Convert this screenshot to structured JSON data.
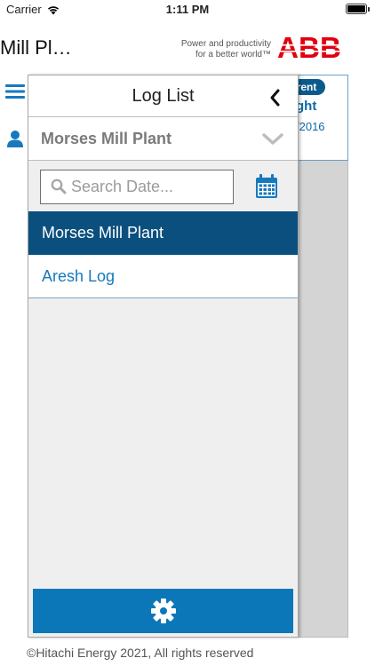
{
  "status_bar": {
    "carrier": "Carrier",
    "time": "1:11 PM",
    "icons": [
      "wifi-icon",
      "battery-icon"
    ]
  },
  "header": {
    "title": "Mill Pl…",
    "tagline_line1": "Power and productivity",
    "tagline_line2": "for a better world™",
    "logo": "ABB",
    "brand_color": "#e2000f"
  },
  "side_icons": [
    "menu-icon",
    "user-icon"
  ],
  "background_card": {
    "badge": "rrent",
    "shift": "ght",
    "date": "/2016"
  },
  "drawer": {
    "title": "Log List",
    "plant_select": {
      "selected": "Morses Mill Plant"
    },
    "search": {
      "placeholder": "Search Date...",
      "value": ""
    },
    "logs": [
      {
        "label": "Morses Mill Plant",
        "selected": true
      },
      {
        "label": "Aresh Log",
        "selected": false
      }
    ],
    "colors": {
      "selected_bg": "#0b4f7e",
      "link_text": "#1679bd",
      "settings_bar": "#0b77b9"
    }
  },
  "footer": {
    "copyright": "©Hitachi Energy 2021, All rights reserved"
  }
}
